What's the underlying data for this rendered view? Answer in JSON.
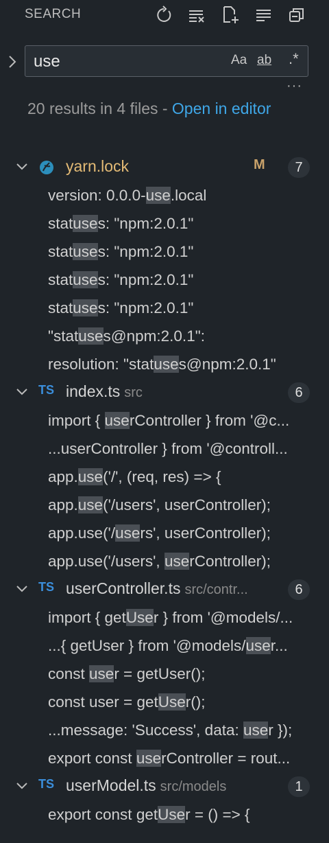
{
  "header": {
    "title": "SEARCH",
    "icons": [
      "refresh-icon",
      "clear-results-icon",
      "new-search-editor-icon",
      "view-as-list-icon",
      "collapse-all-icon"
    ]
  },
  "search": {
    "value": "use",
    "options": {
      "case": "Aa",
      "word": "ab",
      "regex": ".*"
    }
  },
  "summary": {
    "text": "20 results in 4 files - ",
    "link": "Open in editor"
  },
  "more": "···",
  "files": [
    {
      "name": "yarn.lock",
      "path": "",
      "icon": "yarn",
      "modified": "M",
      "count": "7",
      "matches": [
        {
          "pre": "version: 0.0.0-",
          "hit": "use",
          "post": ".local"
        },
        {
          "pre": "stat",
          "hit": "use",
          "post": "s: \"npm:2.0.1\""
        },
        {
          "pre": "stat",
          "hit": "use",
          "post": "s: \"npm:2.0.1\""
        },
        {
          "pre": "stat",
          "hit": "use",
          "post": "s: \"npm:2.0.1\""
        },
        {
          "pre": "stat",
          "hit": "use",
          "post": "s: \"npm:2.0.1\""
        },
        {
          "pre": "\"stat",
          "hit": "use",
          "post": "s@npm:2.0.1\":"
        },
        {
          "pre": "resolution: \"stat",
          "hit": "use",
          "post": "s@npm:2.0.1\""
        }
      ]
    },
    {
      "name": "index.ts",
      "path": "src",
      "icon": "TS",
      "modified": "",
      "count": "6",
      "matches": [
        {
          "pre": "import { ",
          "hit": "use",
          "post": "rController } from '@c..."
        },
        {
          "pre": "...userController } from '@controll...",
          "hit": "",
          "post": ""
        },
        {
          "pre": "app.",
          "hit": "use",
          "post": "('/', (req, res) => {"
        },
        {
          "pre": "app.",
          "hit": "use",
          "post": "('/users', userController);"
        },
        {
          "pre": "app.use('/",
          "hit": "use",
          "post": "rs', userController);"
        },
        {
          "pre": "app.use('/users', ",
          "hit": "use",
          "post": "rController);"
        }
      ]
    },
    {
      "name": "userController.ts",
      "path": "src/contr...",
      "icon": "TS",
      "modified": "",
      "count": "6",
      "matches": [
        {
          "pre": "import { get",
          "hit": "Use",
          "post": "r } from '@models/..."
        },
        {
          "pre": "...{ getUser } from '@models/",
          "hit": "use",
          "post": "r..."
        },
        {
          "pre": "const ",
          "hit": "use",
          "post": "r = getUser();"
        },
        {
          "pre": "const user = get",
          "hit": "Use",
          "post": "r();"
        },
        {
          "pre": "...message: 'Success', data: ",
          "hit": "use",
          "post": "r });"
        },
        {
          "pre": "export const ",
          "hit": "use",
          "post": "rController = rout..."
        }
      ]
    },
    {
      "name": "userModel.ts",
      "path": "src/models",
      "icon": "TS",
      "modified": "",
      "count": "1",
      "matches": [
        {
          "pre": "export const get",
          "hit": "Use",
          "post": "r = () => {"
        }
      ]
    }
  ]
}
